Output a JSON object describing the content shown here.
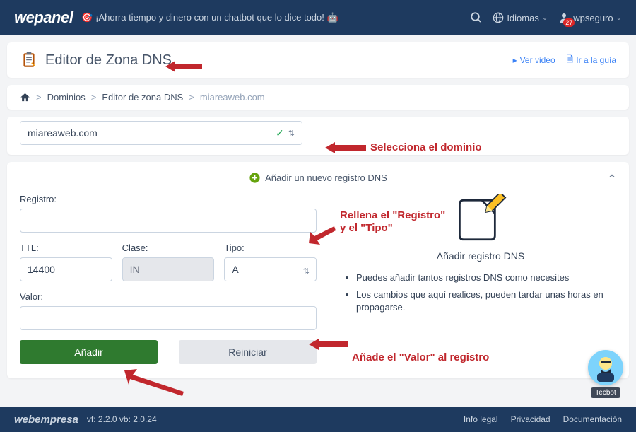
{
  "header": {
    "logo": "wepanel",
    "promo": "🎯 ¡Ahorra tiempo y dinero con un chatbot que lo dice todo! 🤖",
    "language_label": "Idiomas",
    "user_label": "wpseguro",
    "notif_badge": "27"
  },
  "page": {
    "title": "Editor de Zona DNS",
    "video_link": "Ver video",
    "guide_link": "Ir a la guía"
  },
  "breadcrumb": {
    "home": "🏠",
    "level1": "Dominios",
    "level2": "Editor de zona DNS",
    "current": "miareaweb.com"
  },
  "domain_select": {
    "value": "miareaweb.com"
  },
  "section": {
    "title": "Añadir un nuevo registro DNS"
  },
  "form": {
    "registro_label": "Registro:",
    "registro_value": "",
    "ttl_label": "TTL:",
    "ttl_value": "14400",
    "clase_label": "Clase:",
    "clase_value": "IN",
    "tipo_label": "Tipo:",
    "tipo_value": "A",
    "valor_label": "Valor:",
    "valor_value": "",
    "add_btn": "Añadir",
    "reset_btn": "Reiniciar"
  },
  "help": {
    "caption": "Añadir registro DNS",
    "bullets": [
      "Puedes añadir tantos registros DNS como necesites",
      "Los cambios que aquí realices, pueden tardar unas horas en propagarse."
    ]
  },
  "annotations": {
    "a1": "Selecciona el dominio",
    "a2": "Rellena el \"Registro\"\ny el \"Tipo\"",
    "a3": "Añade el \"Valor\" al registro"
  },
  "footer": {
    "logo": "webempresa",
    "version": "vf: 2.2.0 vb: 2.0.24",
    "links": [
      "Info legal",
      "Privacidad",
      "Documentación"
    ]
  },
  "tecbot": {
    "label": "Tecbot"
  },
  "icons": {
    "search": "search-icon",
    "globe": "globe-icon",
    "user": "user-icon",
    "chevron_down": "chevron-down-icon",
    "clipboard": "clipboard-icon",
    "play": "play-icon",
    "doc": "doc-icon",
    "home": "home-icon",
    "check": "check-icon",
    "updown": "updown-icon",
    "plus_circle": "plus-circle-icon",
    "chevron_up": "chevron-up-icon",
    "pencil_note": "pencil-note-icon"
  },
  "colors": {
    "navy": "#1e3a5f",
    "accent_green": "#2f7a2f",
    "anno_red": "#c1272d",
    "link_blue": "#3b82f6"
  }
}
